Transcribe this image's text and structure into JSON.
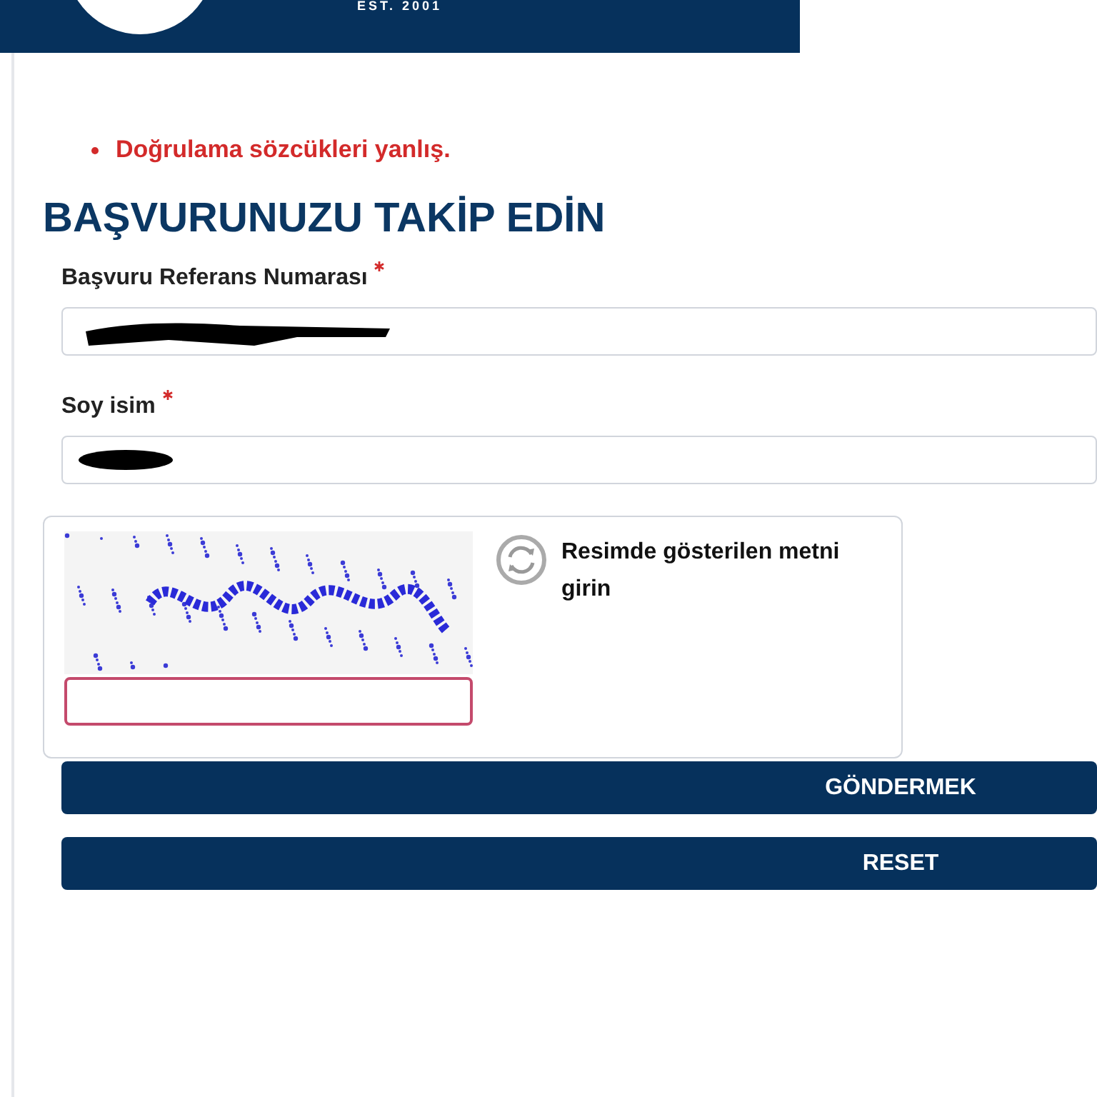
{
  "header": {
    "tagline": "EST. 2001"
  },
  "errors": [
    "Doğrulama sözcükleri yanlış."
  ],
  "title": "BAŞVURUNUZU TAKİP EDİN",
  "fields": [
    {
      "label": "Başvuru Referans Numarası",
      "required": true,
      "redacted": true
    },
    {
      "label": "Soy isim",
      "required": true,
      "redacted": true
    }
  ],
  "captcha": {
    "prompt": "Resimde gösterilen metni girin",
    "invalid": true
  },
  "buttons": [
    "GÖNDERMEK",
    "RESET"
  ]
}
